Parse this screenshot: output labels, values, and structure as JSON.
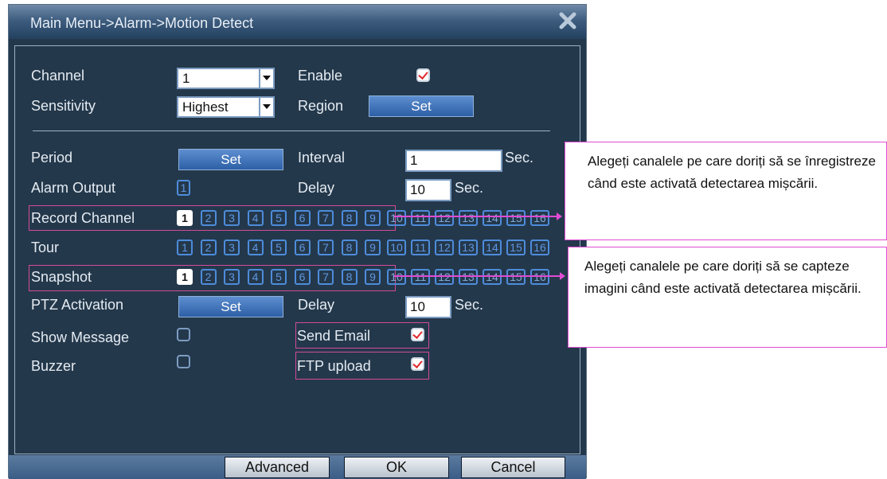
{
  "dialog": {
    "title": "Main Menu->Alarm->Motion Detect",
    "labels": {
      "channel": "Channel",
      "enable": "Enable",
      "sensitivity": "Sensitivity",
      "region": "Region",
      "period": "Period",
      "interval": "Interval",
      "alarm_output": "Alarm Output",
      "delay": "Delay",
      "record_channel": "Record Channel",
      "tour": "Tour",
      "snapshot": "Snapshot",
      "ptz_activation": "PTZ Activation",
      "delay2": "Delay",
      "show_message": "Show Message",
      "send_email": "Send Email",
      "buzzer": "Buzzer",
      "ftp_upload": "FTP upload"
    },
    "values": {
      "channel": "1",
      "sensitivity": "Highest",
      "interval": "1",
      "interval_unit": "Sec.",
      "delay": "10",
      "delay_unit": "Sec.",
      "ptz_delay": "10",
      "ptz_delay_unit": "Sec.",
      "alarm_output": "1"
    },
    "checks": {
      "enable": true,
      "show_message": false,
      "send_email": true,
      "buzzer": false,
      "ftp_upload": true
    },
    "buttons": {
      "region_set": "Set",
      "period_set": "Set",
      "ptz_set": "Set",
      "advanced": "Advanced",
      "ok": "OK",
      "cancel": "Cancel"
    },
    "channels": [
      "1",
      "2",
      "3",
      "4",
      "5",
      "6",
      "7",
      "8",
      "9",
      "10",
      "11",
      "12",
      "13",
      "14",
      "15",
      "16"
    ],
    "record_channel_selected": [
      "1"
    ],
    "snapshot_selected": [
      "1"
    ],
    "tour_selected": []
  },
  "callouts": {
    "record": "Alegeți canalele pe care doriți să se înregistreze când este activată detectarea mișcării.",
    "snapshot": "Alegeți canalele pe care doriți să se capteze imagini când este activată detectarea mișcării."
  },
  "colors": {
    "panel": "#24384b",
    "accent": "#4d8cdb",
    "callout_border": "#e14bd2",
    "check": "#e0282f"
  },
  "icons": {
    "close": "close-icon",
    "dropdown": "chevron-down-icon"
  }
}
